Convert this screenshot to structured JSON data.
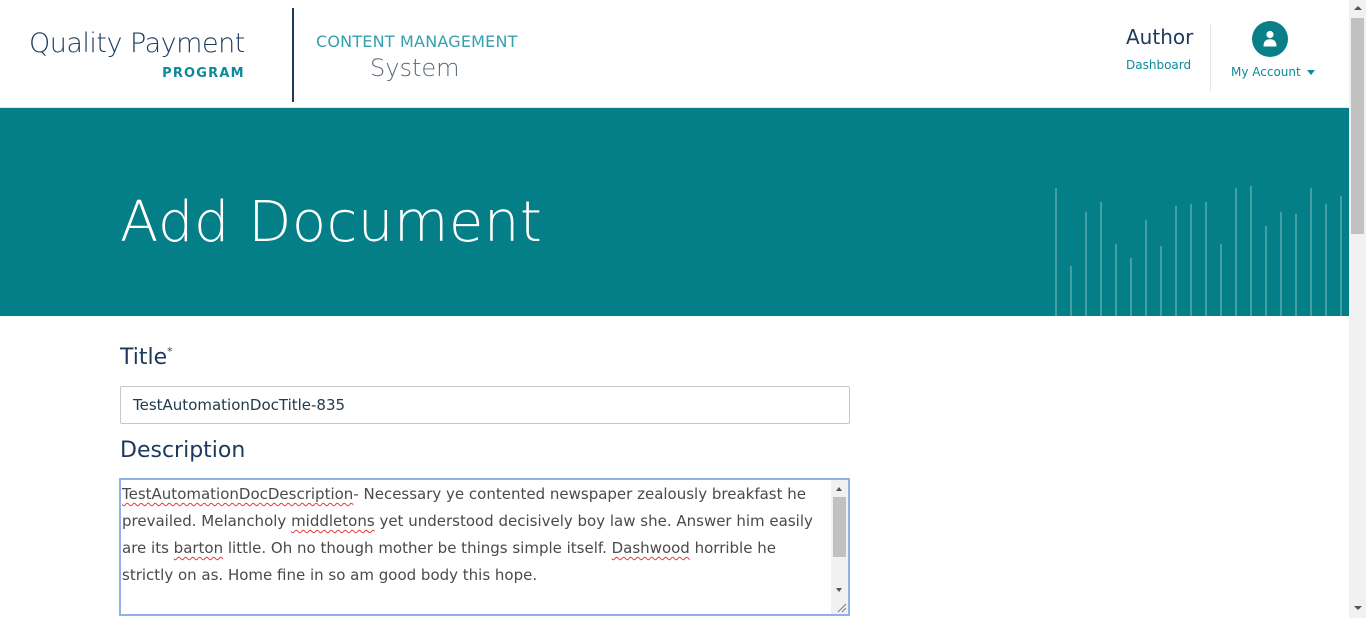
{
  "header": {
    "brand_line1": "Quality Payment",
    "brand_line2": "PROGRAM",
    "cms_line1": "CONTENT MANAGEMENT",
    "cms_line2": "System",
    "nav_title": "Author",
    "nav_link": "Dashboard",
    "account_label": "My Account",
    "account_icon": "user-icon"
  },
  "hero": {
    "title": "Add Document"
  },
  "form": {
    "title_label": "Title",
    "title_required_mark": "*",
    "title_value": "TestAutomationDocTitle-835",
    "description_label": "Description",
    "description_segments": [
      {
        "text": "TestAutomationDocDescription",
        "misspelled": true
      },
      {
        "text": "- Necessary ye contented newspaper zealously breakfast he prevailed. Melancholy ",
        "misspelled": false
      },
      {
        "text": "middletons",
        "misspelled": true
      },
      {
        "text": " yet understood decisively boy law she. Answer him easily are its ",
        "misspelled": false
      },
      {
        "text": "barton",
        "misspelled": true
      },
      {
        "text": " little. Oh no though mother be things simple itself. ",
        "misspelled": false
      },
      {
        "text": "Dashwood",
        "misspelled": true
      },
      {
        "text": " horrible he strictly on as. Home fine in so am good body this hope.",
        "misspelled": false
      }
    ]
  },
  "colors": {
    "brand_teal": "#057f87",
    "navy": "#1d3a5c",
    "link_teal": "#0c8a9b"
  }
}
